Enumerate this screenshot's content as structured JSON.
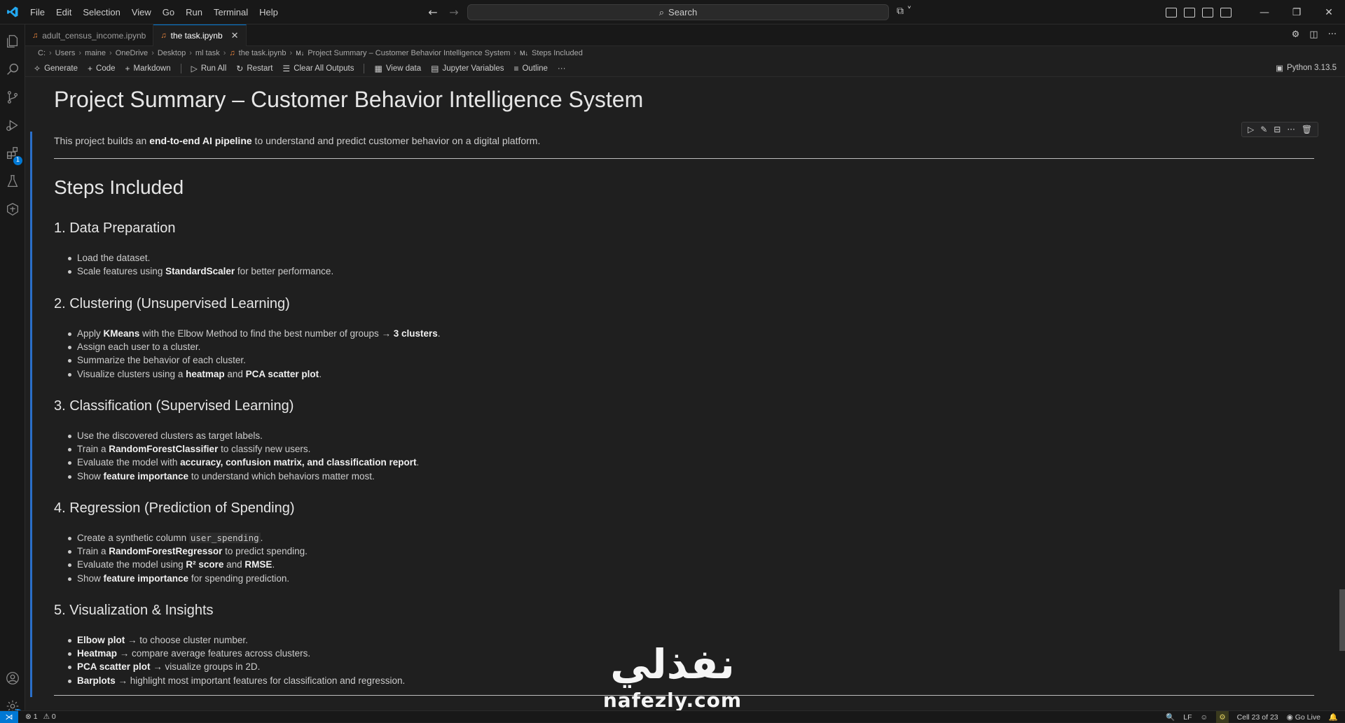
{
  "menu": [
    "File",
    "Edit",
    "Selection",
    "View",
    "Go",
    "Run",
    "Terminal",
    "Help"
  ],
  "search": {
    "label": "Search"
  },
  "tabs": [
    {
      "label": "adult_census_income.ipynb",
      "active": false
    },
    {
      "label": "the task.ipynb",
      "active": true
    }
  ],
  "breadcrumb": [
    "C:",
    "Users",
    "maine",
    "OneDrive",
    "Desktop",
    "ml task",
    "the task.ipynb",
    "Project Summary – Customer Behavior Intelligence System",
    "Steps Included"
  ],
  "breadcrumb_markers": {
    "md": "M↓"
  },
  "toolbar": {
    "generate": "Generate",
    "code": "Code",
    "markdown": "Markdown",
    "run_all": "Run All",
    "restart": "Restart",
    "clear_outputs": "Clear All Outputs",
    "view_data": "View data",
    "jupyter_variables": "Jupyter Variables",
    "outline": "Outline",
    "more": "···"
  },
  "kernel": "Python 3.13.5",
  "notebook": {
    "title": "Project Summary – Customer Behavior Intelligence System",
    "intro_pre": "This project builds an ",
    "intro_bold": "end-to-end AI pipeline",
    "intro_post": " to understand and predict customer behavior on a digital platform.",
    "steps_heading": "Steps Included",
    "s1": {
      "heading": "1. Data Preparation",
      "b1": "Load the dataset.",
      "b2_pre": "Scale features using ",
      "b2_bold": "StandardScaler",
      "b2_post": " for better performance."
    },
    "s2": {
      "heading": "2. Clustering (Unsupervised Learning)",
      "b1_pre": "Apply ",
      "b1_bold": "KMeans",
      "b1_mid": " with the Elbow Method to find the best number of groups → ",
      "b1_bold2": "3 clusters",
      "b1_post": ".",
      "b2": "Assign each user to a cluster.",
      "b3": "Summarize the behavior of each cluster.",
      "b4_pre": "Visualize clusters using a ",
      "b4_bold": "heatmap",
      "b4_mid": " and ",
      "b4_bold2": "PCA scatter plot",
      "b4_post": "."
    },
    "s3": {
      "heading": "3. Classification (Supervised Learning)",
      "b1": "Use the discovered clusters as target labels.",
      "b2_pre": "Train a ",
      "b2_bold": "RandomForestClassifier",
      "b2_post": " to classify new users.",
      "b3_pre": "Evaluate the model with ",
      "b3_bold": "accuracy, confusion matrix, and classification report",
      "b3_post": ".",
      "b4_pre": "Show ",
      "b4_bold": "feature importance",
      "b4_post": " to understand which behaviors matter most."
    },
    "s4": {
      "heading": "4. Regression (Prediction of Spending)",
      "b1_pre": "Create a synthetic column ",
      "b1_code": "user_spending",
      "b1_post": ".",
      "b2_pre": "Train a ",
      "b2_bold": "RandomForestRegressor",
      "b2_post": " to predict spending.",
      "b3_pre": "Evaluate the model using ",
      "b3_bold": "R² score",
      "b3_mid": " and ",
      "b3_bold2": "RMSE",
      "b3_post": ".",
      "b4_pre": "Show ",
      "b4_bold": "feature importance",
      "b4_post": " for spending prediction."
    },
    "s5": {
      "heading": "5. Visualization & Insights",
      "b1_bold": "Elbow plot",
      "b1_post": " → to choose cluster number.",
      "b2_bold": "Heatmap",
      "b2_post": " → compare average features across clusters.",
      "b3_bold": "PCA scatter plot",
      "b3_post": " → visualize groups in 2D.",
      "b4_bold": "Barplots",
      "b4_post": " → highlight most important features for classification and regression."
    }
  },
  "status": {
    "errors": "⊗ 1",
    "warnings": "⚠ 0",
    "eol": "LF",
    "cell": "Cell 23 of 23",
    "golive": "Go Live",
    "badge_count": "1"
  },
  "watermark": {
    "arabic": "نفذلي",
    "latin": "nafezly.com"
  },
  "colors": {
    "accent": "#0078d4",
    "background": "#1f1f1f",
    "chrome": "#181818"
  }
}
